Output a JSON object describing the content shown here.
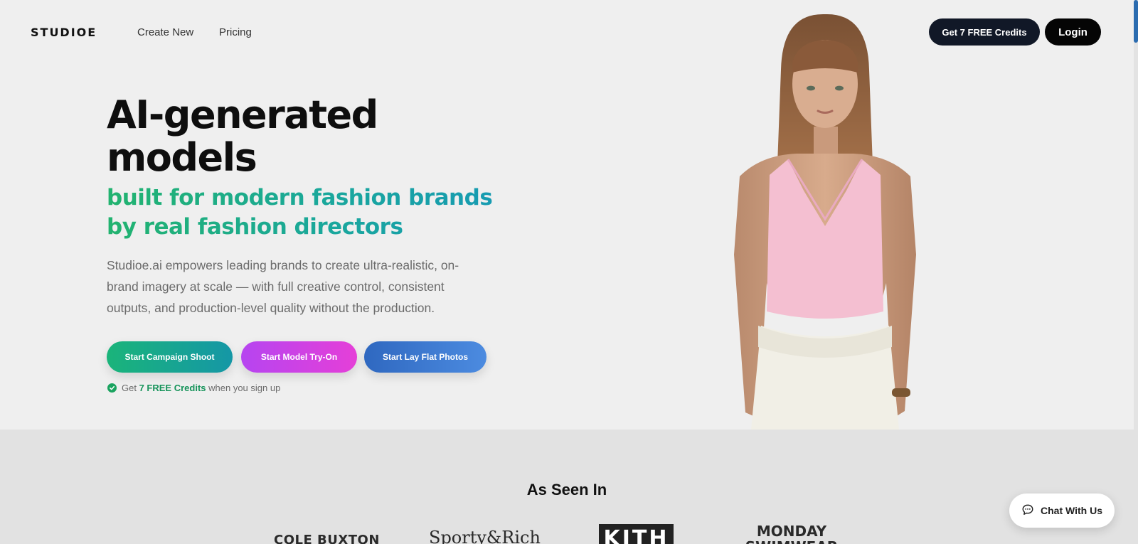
{
  "nav": {
    "logo": "STUDIOE",
    "links": [
      "Create New",
      "Pricing"
    ],
    "credits_button": "Get 7 FREE Credits",
    "login_button": "Login"
  },
  "hero": {
    "headline_line1": "AI-generated",
    "headline_line2": "models",
    "subheadline": "built for modern fashion brands by real fashion directors",
    "description": "Studioe.ai empowers leading brands to create ultra-realistic, on-brand imagery at scale — with full creative control, consistent outputs, and production-level quality without the production.",
    "cta_buttons": [
      "Start Campaign Shoot",
      "Start Model Try-On",
      "Start Lay Flat Photos"
    ],
    "note_prefix": "Get",
    "note_highlight": "7 FREE Credits",
    "note_suffix": "when you sign up"
  },
  "logos": {
    "title": "As Seen In",
    "brands": [
      "COLE BUXTON",
      "Sporty&Rich",
      "KITH",
      "MONDAY SWIMWEAR"
    ]
  },
  "chat": {
    "label": "Chat With Us",
    "icon": "chat-bubble-icon"
  },
  "colors": {
    "accent_green": "#22b36f",
    "accent_teal": "#1699b5",
    "dark_button": "#111827",
    "tryon_pink": "#e53fd8",
    "layflat_blue": "#2f68c0"
  }
}
